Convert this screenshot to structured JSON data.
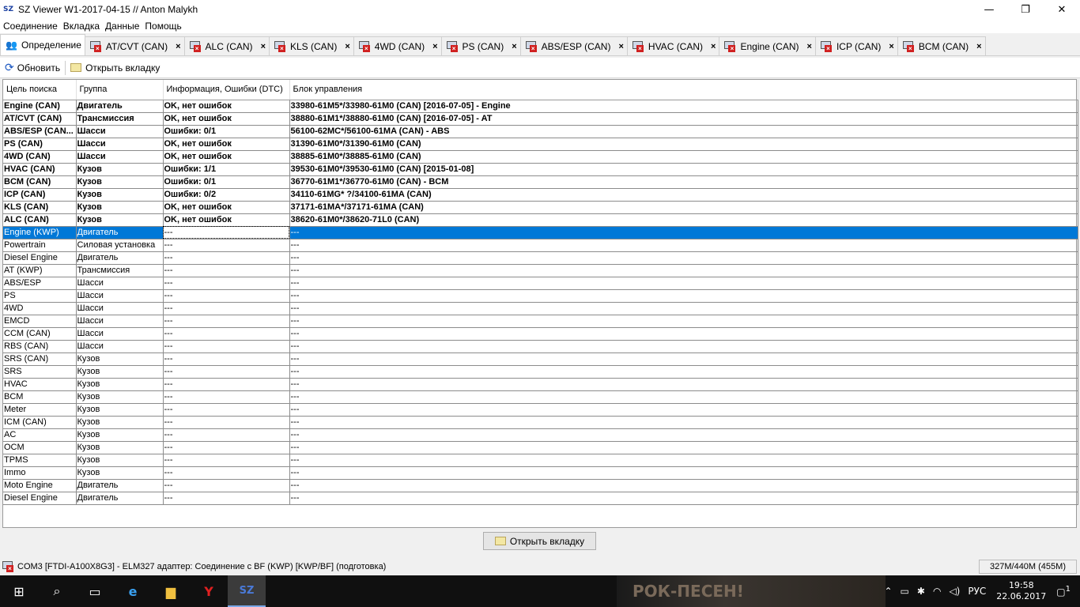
{
  "window": {
    "app_icon": "SZ",
    "title": "SZ Viewer W1-2017-04-15 // Anton Malykh",
    "minimize": "—",
    "maximize": "❐",
    "close": "✕"
  },
  "menu": [
    "Соединение",
    "Вкладка",
    "Данные",
    "Помощь"
  ],
  "tabs": [
    {
      "label": "Определение",
      "active": true
    },
    {
      "label": "AT/CVT (CAN)"
    },
    {
      "label": "ALC (CAN)"
    },
    {
      "label": "KLS (CAN)"
    },
    {
      "label": "4WD (CAN)"
    },
    {
      "label": "PS (CAN)"
    },
    {
      "label": "ABS/ESP (CAN)"
    },
    {
      "label": "HVAC (CAN)"
    },
    {
      "label": "Engine (CAN)"
    },
    {
      "label": "ICP (CAN)"
    },
    {
      "label": "BCM (CAN)"
    }
  ],
  "toolbar": {
    "refresh": "Обновить",
    "open_tab": "Открыть вкладку"
  },
  "table": {
    "headers": [
      "Цель поиска",
      "Группа",
      "Информация, Ошибки (DTC)",
      "Блок управления"
    ],
    "rows": [
      {
        "c": [
          "Engine (CAN)",
          "Двигатель",
          "OK, нет ошибок",
          "33980-61M5*/33980-61M0 (CAN) [2016-07-05] - Engine"
        ],
        "bold": true
      },
      {
        "c": [
          "AT/CVT (CAN)",
          "Трансмиссия",
          "OK, нет ошибок",
          "38880-61M1*/38880-61M0 (CAN) [2016-07-05] - AT"
        ],
        "bold": true
      },
      {
        "c": [
          "ABS/ESP (CAN...",
          "Шасси",
          "Ошибки: 0/1",
          "56100-62MC*/56100-61MA (CAN) - ABS"
        ],
        "bold": true
      },
      {
        "c": [
          "PS (CAN)",
          "Шасси",
          "OK, нет ошибок",
          "31390-61M0*/31390-61M0 (CAN)"
        ],
        "bold": true
      },
      {
        "c": [
          "4WD (CAN)",
          "Шасси",
          "OK, нет ошибок",
          "38885-61M0*/38885-61M0 (CAN)"
        ],
        "bold": true
      },
      {
        "c": [
          "HVAC (CAN)",
          "Кузов",
          "Ошибки: 1/1",
          "39530-61M0*/39530-61M0 (CAN) [2015-01-08]"
        ],
        "bold": true
      },
      {
        "c": [
          "BCM (CAN)",
          "Кузов",
          "Ошибки: 0/1",
          "36770-61M1*/36770-61M0 (CAN) - BCM"
        ],
        "bold": true
      },
      {
        "c": [
          "ICP (CAN)",
          "Кузов",
          "Ошибки: 0/2",
          "34110-61MG*    ?/34100-61MA (CAN)"
        ],
        "bold": true
      },
      {
        "c": [
          "KLS (CAN)",
          "Кузов",
          "OK, нет ошибок",
          "37171-61MA*/37171-61MA (CAN)"
        ],
        "bold": true
      },
      {
        "c": [
          "ALC (CAN)",
          "Кузов",
          "OK, нет ошибок",
          "38620-61M0*/38620-71L0 (CAN)"
        ],
        "bold": true
      },
      {
        "c": [
          "Engine (KWP)",
          "Двигатель",
          "---",
          "---"
        ],
        "selected": true
      },
      {
        "c": [
          "Powertrain",
          "Силовая установка",
          "---",
          "---"
        ]
      },
      {
        "c": [
          "Diesel Engine",
          "Двигатель",
          "---",
          "---"
        ]
      },
      {
        "c": [
          "AT (KWP)",
          "Трансмиссия",
          "---",
          "---"
        ]
      },
      {
        "c": [
          "ABS/ESP",
          "Шасси",
          "---",
          "---"
        ]
      },
      {
        "c": [
          "PS",
          "Шасси",
          "---",
          "---"
        ]
      },
      {
        "c": [
          "4WD",
          "Шасси",
          "---",
          "---"
        ]
      },
      {
        "c": [
          "EMCD",
          "Шасси",
          "---",
          "---"
        ]
      },
      {
        "c": [
          "CCM (CAN)",
          "Шасси",
          "---",
          "---"
        ]
      },
      {
        "c": [
          "RBS (CAN)",
          "Шасси",
          "---",
          "---"
        ]
      },
      {
        "c": [
          "SRS (CAN)",
          "Кузов",
          "---",
          "---"
        ]
      },
      {
        "c": [
          "SRS",
          "Кузов",
          "---",
          "---"
        ]
      },
      {
        "c": [
          "HVAC",
          "Кузов",
          "---",
          "---"
        ]
      },
      {
        "c": [
          "BCM",
          "Кузов",
          "---",
          "---"
        ]
      },
      {
        "c": [
          "Meter",
          "Кузов",
          "---",
          "---"
        ]
      },
      {
        "c": [
          "ICM (CAN)",
          "Кузов",
          "---",
          "---"
        ]
      },
      {
        "c": [
          "AC",
          "Кузов",
          "---",
          "---"
        ]
      },
      {
        "c": [
          "OCM",
          "Кузов",
          "---",
          "---"
        ]
      },
      {
        "c": [
          "TPMS",
          "Кузов",
          "---",
          "---"
        ]
      },
      {
        "c": [
          "Immo",
          "Кузов",
          "---",
          "---"
        ]
      },
      {
        "c": [
          "Moto Engine",
          "Двигатель",
          "---",
          "---"
        ]
      },
      {
        "c": [
          "Diesel Engine",
          "Двигатель",
          "---",
          "---"
        ]
      }
    ]
  },
  "bottom_button": "Открыть вкладку",
  "status": {
    "text": "COM3 [FTDI-A100X8G3] - ELM327 адаптер: Соединение с BF  (KWP) [KWP/BF] (подготовка)",
    "memory": "327M/440M (455M)"
  },
  "taskbar": {
    "background_text": "РОК-ПЕСЕН!",
    "lang": "РУС",
    "time": "19:58",
    "date": "22.06.2017",
    "notifications": "1",
    "szlabel": "SZ"
  },
  "colors": {
    "selection": "#0078d7"
  }
}
